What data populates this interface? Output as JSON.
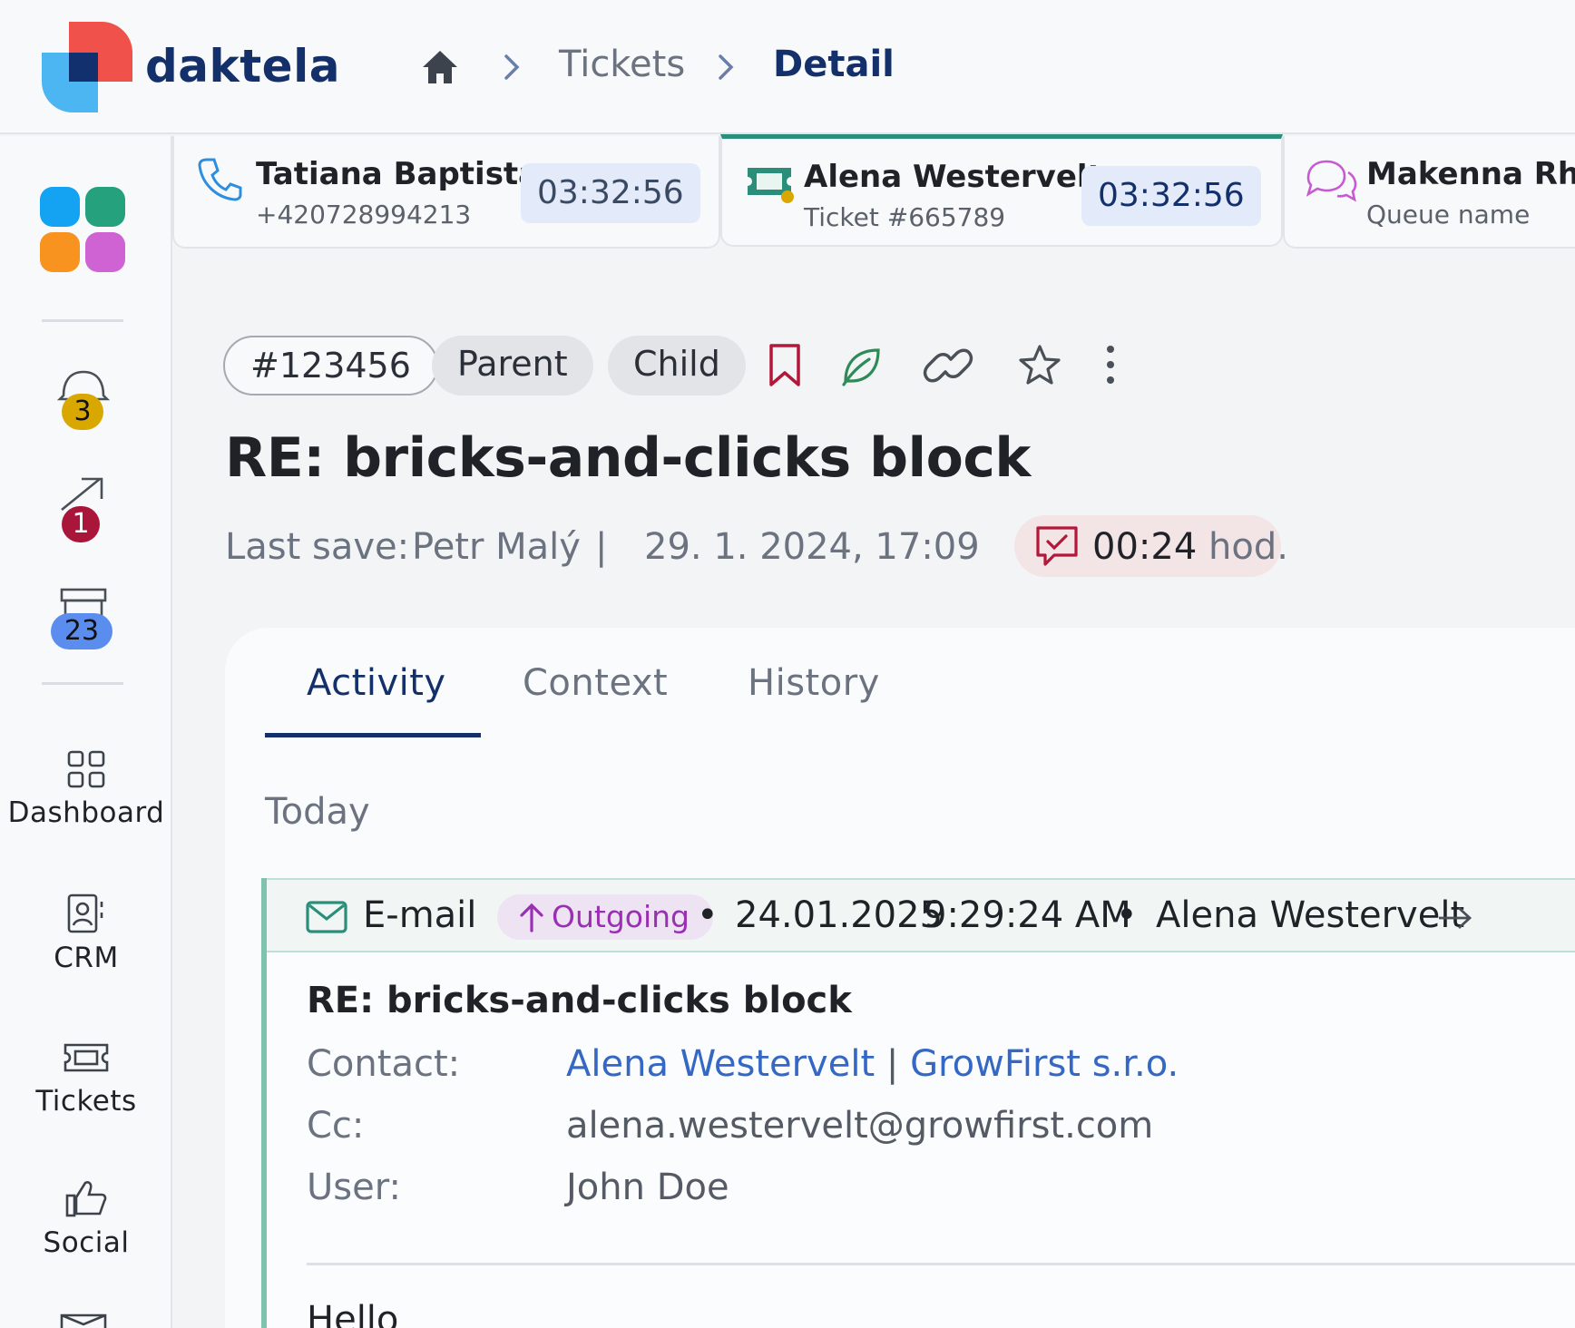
{
  "app": {
    "name": "daktela"
  },
  "breadcrumb": {
    "tickets": "Tickets",
    "detail": "Detail"
  },
  "sidebar": {
    "badges": {
      "notifications": "3",
      "outgoing": "1",
      "archive": "23"
    },
    "nav": [
      {
        "label": "Dashboard"
      },
      {
        "label": "CRM"
      },
      {
        "label": "Tickets"
      },
      {
        "label": "Social"
      }
    ]
  },
  "conversations": [
    {
      "name": "Tatiana Baptista",
      "sub": "+420728994213",
      "timer": "03:32:56",
      "type": "phone-icon"
    },
    {
      "name": "Alena Westervelt",
      "sub": "Ticket #665789",
      "timer": "03:32:56",
      "type": "ticket-icon"
    },
    {
      "name": "Makenna Rhiel",
      "sub": "Queue name",
      "type": "chat-icon"
    }
  ],
  "ticket": {
    "id": "#123456",
    "parent": "Parent",
    "child": "Child",
    "title": "RE: bricks-and-clicks block",
    "last_save_label": "Last save:",
    "last_save_user": "Petr Malý",
    "separator": "|",
    "last_save_date": "29. 1. 2024, 17:09",
    "sla_time": "00:24",
    "sla_unit": "hod."
  },
  "tabs": {
    "activity": "Activity",
    "context": "Context",
    "history": "History"
  },
  "timeline": {
    "group_label": "Today"
  },
  "email": {
    "channel": "E-mail",
    "direction": "Outgoing",
    "bullet": "•",
    "date": "24.01.2025",
    "time": "9:29:24 AM",
    "agent": "Alena Westervelt",
    "subject": "RE: bricks-and-clicks block",
    "contact_label": "Contact:",
    "contact_name": "Alena Westervelt",
    "contact_sep": "|",
    "contact_company": "GrowFirst s.r.o.",
    "cc_label": "Cc:",
    "cc_value": "alena.westervelt@growfirst.com",
    "user_label": "User:",
    "user_value": "John Doe",
    "body_start": "Hello"
  },
  "colors": {
    "brand_navy": "#13306b",
    "accent_teal": "#2a8f7a",
    "badge_yellow": "#d9a800",
    "badge_red": "#a9163a",
    "badge_blue": "#5b8def",
    "outgoing_purple": "#9b2fb4",
    "link_blue": "#3568c4"
  }
}
